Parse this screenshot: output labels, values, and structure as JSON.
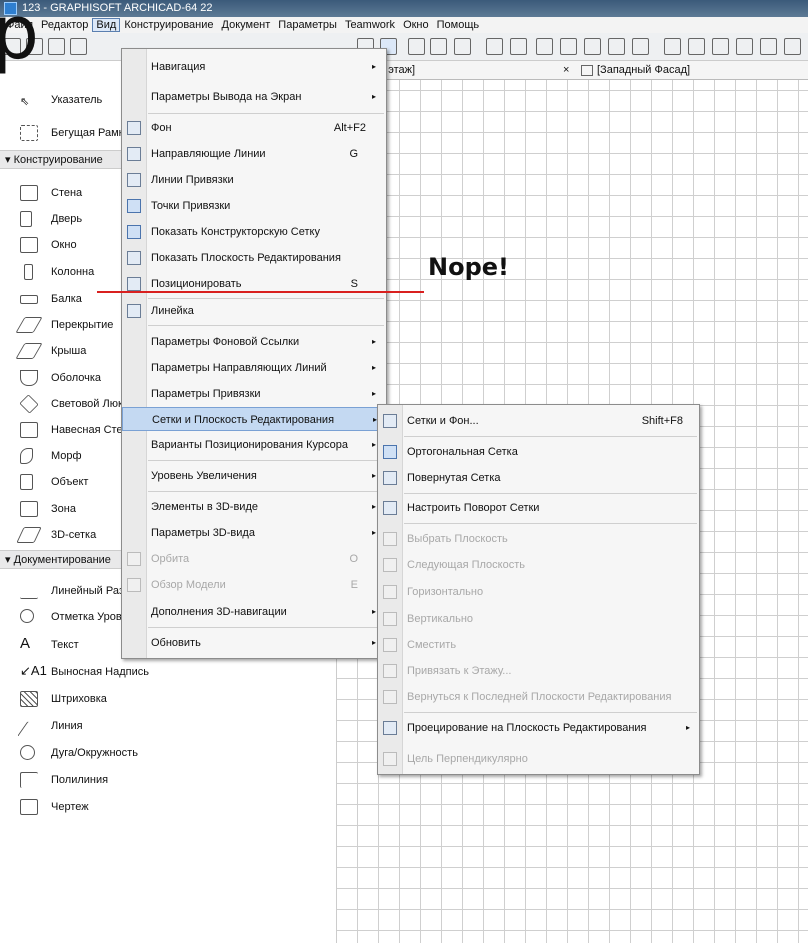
{
  "window": {
    "title": "123 - GRAPHISOFT ARCHICAD-64 22"
  },
  "menubar": {
    "items": [
      "Файл",
      "Редактор",
      "Вид",
      "Конструирование",
      "Документ",
      "Параметры",
      "Teamwork",
      "Окно",
      "Помощь"
    ],
    "active": "Вид"
  },
  "tabs": [
    {
      "label": "й этаж]"
    },
    {
      "label": "×"
    },
    {
      "label": "[Западный Фасад]"
    }
  ],
  "overlay": {
    "big_text": "р",
    "annotation": "Nope!"
  },
  "sidebar": {
    "top": [
      {
        "label": "Указатель",
        "icon": "arrow-pointer-icon"
      },
      {
        "label": "Бегущая Рамка",
        "icon": "marquee-icon"
      }
    ],
    "section_design": "Конструирование",
    "design_tools": [
      {
        "label": "Стена",
        "icon": "wall-icon"
      },
      {
        "label": "Дверь",
        "icon": "door-icon"
      },
      {
        "label": "Окно",
        "icon": "window-icon"
      },
      {
        "label": "Колонна",
        "icon": "column-icon"
      },
      {
        "label": "Балка",
        "icon": "beam-icon"
      },
      {
        "label": "Перекрытие",
        "icon": "slab-icon"
      },
      {
        "label": "Крыша",
        "icon": "roof-icon"
      },
      {
        "label": "Оболочка",
        "icon": "shell-icon"
      },
      {
        "label": "Световой Люк",
        "icon": "skylight-icon"
      },
      {
        "label": "Навесная Стена",
        "icon": "curtain-wall-icon"
      },
      {
        "label": "Морф",
        "icon": "morph-icon"
      },
      {
        "label": "Объект",
        "icon": "object-icon"
      },
      {
        "label": "Зона",
        "icon": "zone-icon"
      },
      {
        "label": "3D-сетка",
        "icon": "mesh-icon"
      }
    ],
    "section_document": "Документирование",
    "doc_tools": [
      {
        "label": "Линейный Размер",
        "icon": "dimension-icon"
      },
      {
        "label": "Отметка Уровня",
        "icon": "level-marker-icon"
      },
      {
        "label": "Текст",
        "icon": "text-icon"
      },
      {
        "label": "Выносная Надпись",
        "icon": "label-icon"
      },
      {
        "label": "Штриховка",
        "icon": "fill-icon"
      },
      {
        "label": "Линия",
        "icon": "line-icon"
      },
      {
        "label": "Дуга/Окружность",
        "icon": "arc-icon"
      },
      {
        "label": "Полилиния",
        "icon": "polyline-icon"
      },
      {
        "label": "Чертеж",
        "icon": "drawing-icon"
      }
    ]
  },
  "view_menu": {
    "items": [
      {
        "label": "Навигация",
        "arrow": "▸"
      },
      {
        "label": "Параметры Вывода на Экран",
        "arrow": "▸"
      },
      {
        "label": "Фон",
        "shortcut": "Alt+F2",
        "icon": "background-icon"
      },
      {
        "label": "Направляющие Линии",
        "shortcut": "G",
        "icon": "guide-lines-icon"
      },
      {
        "label": "Линии Привязки",
        "icon": "snap-lines-icon"
      },
      {
        "label": "Точки Привязки",
        "icon": "snap-points-icon"
      },
      {
        "label": "Показать Конструкторскую Сетку",
        "icon": "construction-grid-icon"
      },
      {
        "label": "Показать Плоскость Редактирования",
        "icon": "editing-plane-icon"
      },
      {
        "label": "Позиционировать",
        "shortcut": "S",
        "icon": "positioning-icon"
      },
      {
        "label": "Линейка",
        "icon": "ruler-icon"
      },
      {
        "label": "Параметры Фоновой Ссылки",
        "arrow": "▸"
      },
      {
        "label": "Параметры Направляющих Линий",
        "arrow": "▸"
      },
      {
        "label": "Параметры Привязки",
        "arrow": "▸"
      },
      {
        "label": "Сетки и Плоскость Редактирования",
        "arrow": "▸"
      },
      {
        "label": "Варианты Позиционирования Курсора",
        "arrow": "▸"
      },
      {
        "label": "Уровень Увеличения",
        "arrow": "▸"
      },
      {
        "label": "Элементы в 3D-виде",
        "arrow": "▸"
      },
      {
        "label": "Параметры 3D-вида",
        "arrow": "▸"
      },
      {
        "label": "Орбита",
        "shortcut": "O",
        "icon": "orbit-icon"
      },
      {
        "label": "Обзор Модели",
        "shortcut": "E",
        "icon": "explore-model-icon"
      },
      {
        "label": "Дополнения 3D-навигации",
        "arrow": "▸"
      },
      {
        "label": "Обновить",
        "arrow": "▸"
      }
    ]
  },
  "grids_submenu": {
    "items": [
      {
        "label": "Сетки и Фон...",
        "shortcut": "Shift+F8",
        "icon": "grid-background-icon"
      },
      {
        "label": "Ортогональная Сетка",
        "icon": "orthogonal-grid-icon"
      },
      {
        "label": "Повернутая Сетка",
        "icon": "rotated-grid-icon"
      },
      {
        "label": "Настроить Поворот Сетки",
        "icon": "set-grid-rotation-icon"
      },
      {
        "label": "Выбрать Плоскость",
        "icon": "select-plane-icon"
      },
      {
        "label": "Следующая Плоскость",
        "icon": "next-plane-icon"
      },
      {
        "label": "Горизонтально",
        "icon": "horizontal-plane-icon"
      },
      {
        "label": "Вертикально",
        "icon": "vertical-plane-icon"
      },
      {
        "label": "Сместить",
        "icon": "offset-plane-icon"
      },
      {
        "label": "Привязать к Этажу...",
        "icon": "attach-to-story-icon"
      },
      {
        "label": "Вернуться к Последней Плоскости Редактирования",
        "icon": "return-plane-icon"
      },
      {
        "label": "Проецирование на Плоскость Редактирования",
        "arrow": "▸",
        "icon": "projection-icon"
      },
      {
        "label": "Цель Перпендикулярно",
        "icon": "perpendicular-target-icon"
      }
    ]
  }
}
